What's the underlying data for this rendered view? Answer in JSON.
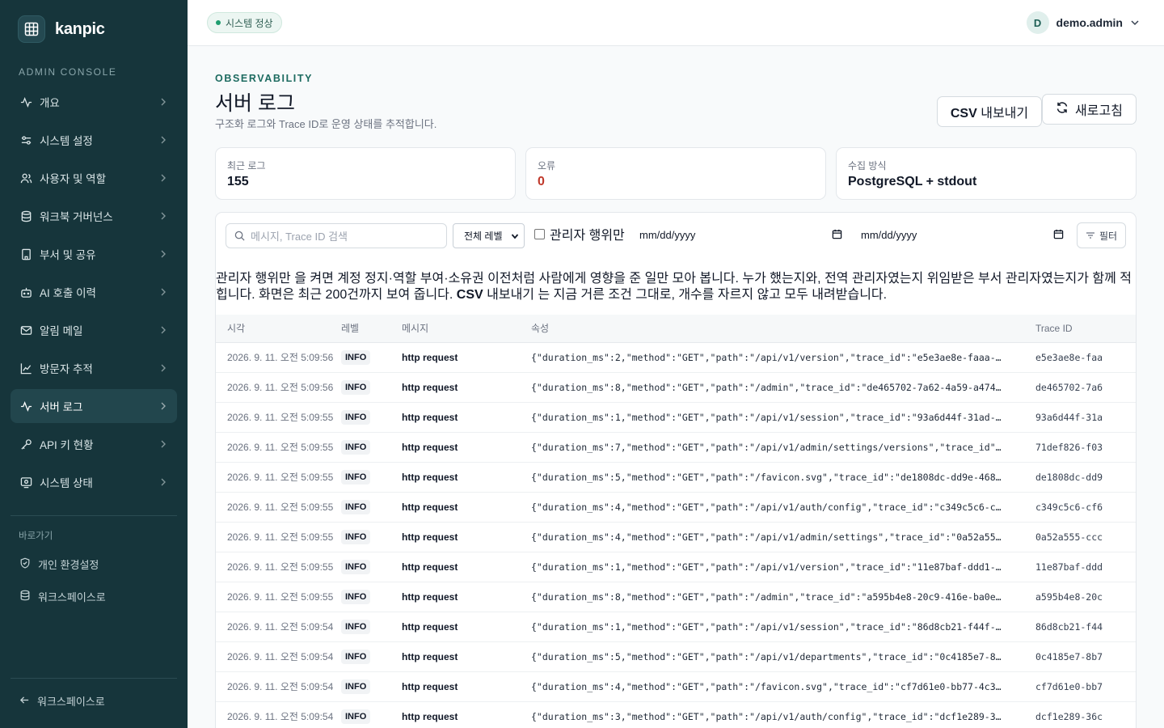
{
  "brand": {
    "name": "kanpic"
  },
  "sidebar": {
    "section_label": "ADMIN CONSOLE",
    "items": [
      {
        "label": "개요",
        "icon": "activity-icon"
      },
      {
        "label": "시스템 설정",
        "icon": "settings-sliders-icon"
      },
      {
        "label": "사용자 및 역할",
        "icon": "users-icon"
      },
      {
        "label": "워크북 거버넌스",
        "icon": "database-icon"
      },
      {
        "label": "부서 및 공유",
        "icon": "building-icon"
      },
      {
        "label": "AI 호출 이력",
        "icon": "bot-icon"
      },
      {
        "label": "알림 메일",
        "icon": "mail-icon"
      },
      {
        "label": "방문자 추적",
        "icon": "line-chart-icon"
      },
      {
        "label": "서버 로그",
        "icon": "activity-icon",
        "active": true
      },
      {
        "label": "API 키 현황",
        "icon": "key-icon"
      },
      {
        "label": "시스템 상태",
        "icon": "monitor-icon"
      }
    ],
    "shortcuts_label": "바로가기",
    "shortcuts": [
      {
        "label": "개인 환경설정",
        "icon": "shield-icon"
      },
      {
        "label": "워크스페이스로",
        "icon": "database-icon"
      }
    ],
    "back_label": "워크스페이스로"
  },
  "topbar": {
    "status": "시스템 정상",
    "user": {
      "initial": "D",
      "name": "demo.admin"
    }
  },
  "header": {
    "eyebrow": "OBSERVABILITY",
    "title": "서버 로그",
    "description": "구조화 로그와 Trace ID로 운영 상태를 추적합니다.",
    "csv_button_bold": "CSV",
    "csv_button_rest": " 내보내기",
    "refresh_button": "새로고침"
  },
  "stats": [
    {
      "label": "최근 로그",
      "value": "155"
    },
    {
      "label": "오류",
      "value": "0",
      "tone": "error"
    },
    {
      "label": "수집 방식",
      "value": "PostgreSQL + stdout"
    }
  ],
  "filters": {
    "search_placeholder": "메시지, Trace ID 검색",
    "level_select": "전체 레벨",
    "admin_only_label": "관리자 행위만",
    "date_from": "mm/dd/yyyy",
    "date_to": "mm/dd/yyyy",
    "filter_button": "필터"
  },
  "note": {
    "part1": "관리자 행위만 을 켜면 계정 정지·역할 부여·소유권 이전처럼 사람에게 영향을 준 일만 모아 봅니다. 누가 했는지와, 전역 관리자였는지 위임받은 부서 관리자였는지가 함께 적힙니다. 화면은 최근 200건까지 보여 줍니다. ",
    "bold": "CSV",
    "part2": " 내보내기 는 지금 거른 조건 그대로, 개수를 자르지 않고 모두 내려받습니다."
  },
  "table": {
    "columns": [
      "시각",
      "레벨",
      "메시지",
      "속성",
      "Trace ID"
    ],
    "rows": [
      {
        "time": "2026. 9. 11. 오전 5:09:56",
        "level": "INFO",
        "message": "http request",
        "attrs": "{\"duration_ms\":2,\"method\":\"GET\",\"path\":\"/api/v1/version\",\"trace_id\":\"e5e3ae8e-faaa-…",
        "trace": "e5e3ae8e-faa"
      },
      {
        "time": "2026. 9. 11. 오전 5:09:56",
        "level": "INFO",
        "message": "http request",
        "attrs": "{\"duration_ms\":8,\"method\":\"GET\",\"path\":\"/admin\",\"trace_id\":\"de465702-7a62-4a59-a474…",
        "trace": "de465702-7a6"
      },
      {
        "time": "2026. 9. 11. 오전 5:09:55",
        "level": "INFO",
        "message": "http request",
        "attrs": "{\"duration_ms\":1,\"method\":\"GET\",\"path\":\"/api/v1/session\",\"trace_id\":\"93a6d44f-31ad-…",
        "trace": "93a6d44f-31a"
      },
      {
        "time": "2026. 9. 11. 오전 5:09:55",
        "level": "INFO",
        "message": "http request",
        "attrs": "{\"duration_ms\":7,\"method\":\"GET\",\"path\":\"/api/v1/admin/settings/versions\",\"trace_id\"…",
        "trace": "71def826-f03"
      },
      {
        "time": "2026. 9. 11. 오전 5:09:55",
        "level": "INFO",
        "message": "http request",
        "attrs": "{\"duration_ms\":5,\"method\":\"GET\",\"path\":\"/favicon.svg\",\"trace_id\":\"de1808dc-dd9e-468…",
        "trace": "de1808dc-dd9"
      },
      {
        "time": "2026. 9. 11. 오전 5:09:55",
        "level": "INFO",
        "message": "http request",
        "attrs": "{\"duration_ms\":4,\"method\":\"GET\",\"path\":\"/api/v1/auth/config\",\"trace_id\":\"c349c5c6-c…",
        "trace": "c349c5c6-cf6"
      },
      {
        "time": "2026. 9. 11. 오전 5:09:55",
        "level": "INFO",
        "message": "http request",
        "attrs": "{\"duration_ms\":4,\"method\":\"GET\",\"path\":\"/api/v1/admin/settings\",\"trace_id\":\"0a52a55…",
        "trace": "0a52a555-ccc"
      },
      {
        "time": "2026. 9. 11. 오전 5:09:55",
        "level": "INFO",
        "message": "http request",
        "attrs": "{\"duration_ms\":1,\"method\":\"GET\",\"path\":\"/api/v1/version\",\"trace_id\":\"11e87baf-ddd1-…",
        "trace": "11e87baf-ddd"
      },
      {
        "time": "2026. 9. 11. 오전 5:09:55",
        "level": "INFO",
        "message": "http request",
        "attrs": "{\"duration_ms\":8,\"method\":\"GET\",\"path\":\"/admin\",\"trace_id\":\"a595b4e8-20c9-416e-ba0e…",
        "trace": "a595b4e8-20c"
      },
      {
        "time": "2026. 9. 11. 오전 5:09:54",
        "level": "INFO",
        "message": "http request",
        "attrs": "{\"duration_ms\":1,\"method\":\"GET\",\"path\":\"/api/v1/session\",\"trace_id\":\"86d8cb21-f44f-…",
        "trace": "86d8cb21-f44"
      },
      {
        "time": "2026. 9. 11. 오전 5:09:54",
        "level": "INFO",
        "message": "http request",
        "attrs": "{\"duration_ms\":5,\"method\":\"GET\",\"path\":\"/api/v1/departments\",\"trace_id\":\"0c4185e7-8…",
        "trace": "0c4185e7-8b7"
      },
      {
        "time": "2026. 9. 11. 오전 5:09:54",
        "level": "INFO",
        "message": "http request",
        "attrs": "{\"duration_ms\":4,\"method\":\"GET\",\"path\":\"/favicon.svg\",\"trace_id\":\"cf7d61e0-bb77-4c3…",
        "trace": "cf7d61e0-bb7"
      },
      {
        "time": "2026. 9. 11. 오전 5:09:54",
        "level": "INFO",
        "message": "http request",
        "attrs": "{\"duration_ms\":3,\"method\":\"GET\",\"path\":\"/api/v1/auth/config\",\"trace_id\":\"dcf1e289-3…",
        "trace": "dcf1e289-36c"
      }
    ]
  },
  "colors": {
    "sidebar_bg": "#16353b",
    "accent": "#1d6b60",
    "error": "#c0392b",
    "status_ok": "#1f9d6f"
  }
}
